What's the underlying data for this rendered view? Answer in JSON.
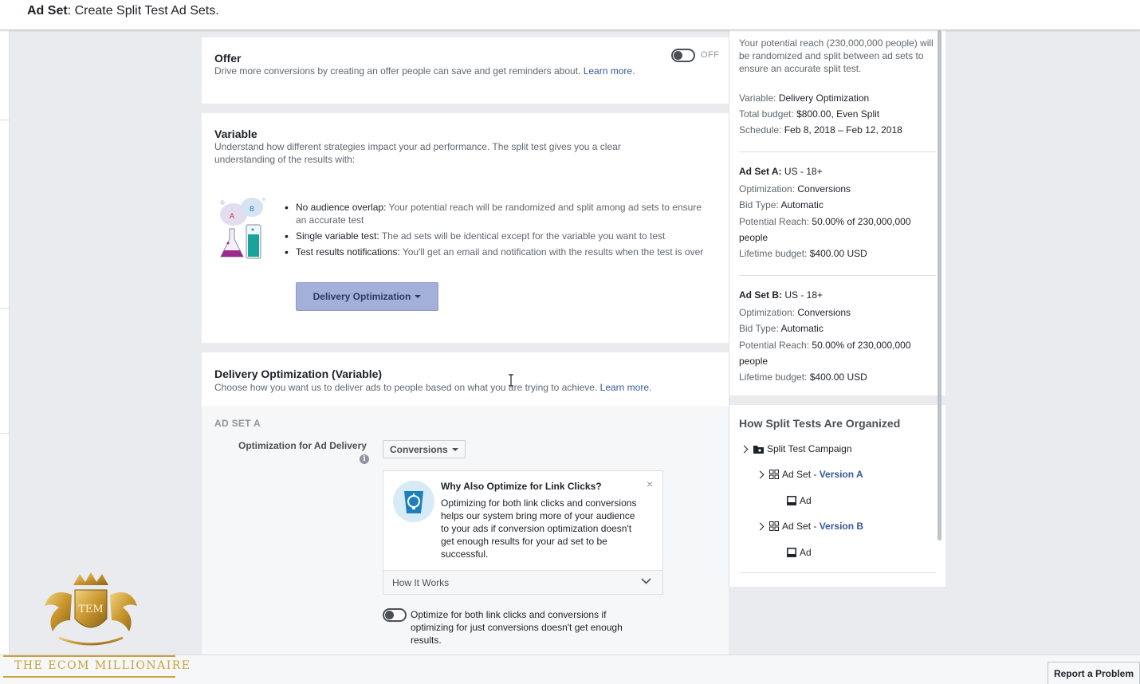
{
  "header": {
    "title_bold": "Ad Set",
    "title_rest": ": Create Split Test Ad Sets."
  },
  "offer": {
    "title": "Offer",
    "desc": "Drive more conversions by creating an offer people can save and get reminders about. ",
    "learn": "Learn more.",
    "toggle_state": "OFF"
  },
  "variable": {
    "title": "Variable",
    "desc": "Understand how different strategies impact your ad performance. The split test gives you a clear understanding of the results with:",
    "bullets": [
      {
        "lead": "No audience overlap:",
        "text": " Your potential reach will be randomized and split among ad sets to ensure an accurate test"
      },
      {
        "lead": "Single variable test:",
        "text": " The ad sets will be identical except for the variable you want to test"
      },
      {
        "lead": "Test results notifications:",
        "text": " You'll get an email and notification with the results when the test is over"
      }
    ],
    "button": "Delivery Optimization",
    "illustration_labels": {
      "a": "A",
      "b": "B"
    }
  },
  "delivery": {
    "title": "Delivery Optimization (Variable)",
    "desc": "Choose how you want us to deliver ads to people based on what you are trying to achieve. ",
    "learn": "Learn more.",
    "ad_set_label": "AD SET A",
    "field_label": "Optimization for Ad Delivery",
    "select_value": "Conversions",
    "info_icon": "i",
    "tip": {
      "title": "Why Also Optimize for Link Clicks?",
      "body": "Optimizing for both link clicks and conversions helps our system bring more of your audience to your ads if conversion optimization doesn't get enough results for your ad set to be successful.",
      "close": "×",
      "how_it_works": "How It Works"
    },
    "toggle_text": "Optimize for both link clicks and conversions if optimizing for just conversions doesn't get enough results."
  },
  "summary": {
    "intro": "Your potential reach (230,000,000 people) will be randomized and split between ad sets to ensure an accurate split test.",
    "variable_label": "Variable: ",
    "variable_value": "Delivery Optimization",
    "budget_label": "Total budget: ",
    "budget_value": "$800.00, Even Split",
    "schedule_label": "Schedule: ",
    "schedule_value": "Feb 8, 2018 – Feb 12, 2018",
    "ad_sets": [
      {
        "name": "Ad Set A:",
        "audience": " US - 18+",
        "opt_label": "Optimization: ",
        "opt_value": "Conversions",
        "bid_label": "Bid Type: ",
        "bid_value": "Automatic",
        "reach_label": "Potential Reach: ",
        "reach_value": "50.00% of 230,000,000 people",
        "budget_label": "Lifetime budget: ",
        "budget_value": "$400.00 USD"
      },
      {
        "name": "Ad Set B:",
        "audience": " US - 18+",
        "opt_label": "Optimization: ",
        "opt_value": "Conversions",
        "bid_label": "Bid Type: ",
        "bid_value": "Automatic",
        "reach_label": "Potential Reach: ",
        "reach_value": "50.00% of 230,000,000 people",
        "budget_label": "Lifetime budget: ",
        "budget_value": "$400.00 USD"
      }
    ],
    "org_title": "How Split Tests Are Organized",
    "tree": {
      "campaign": "Split Test Campaign",
      "ad_set_prefix": "Ad Set - ",
      "version_a": "Version A",
      "version_b": "Version B",
      "ad": "Ad"
    }
  },
  "footer": {
    "report": "Report a Problem"
  },
  "watermark": {
    "text": "THE ECOM MILLIONAIRE",
    "monogram": "TEM"
  },
  "colors": {
    "link": "#365899",
    "button_light": "#a3b0d9",
    "gold": "#c9a23a"
  }
}
